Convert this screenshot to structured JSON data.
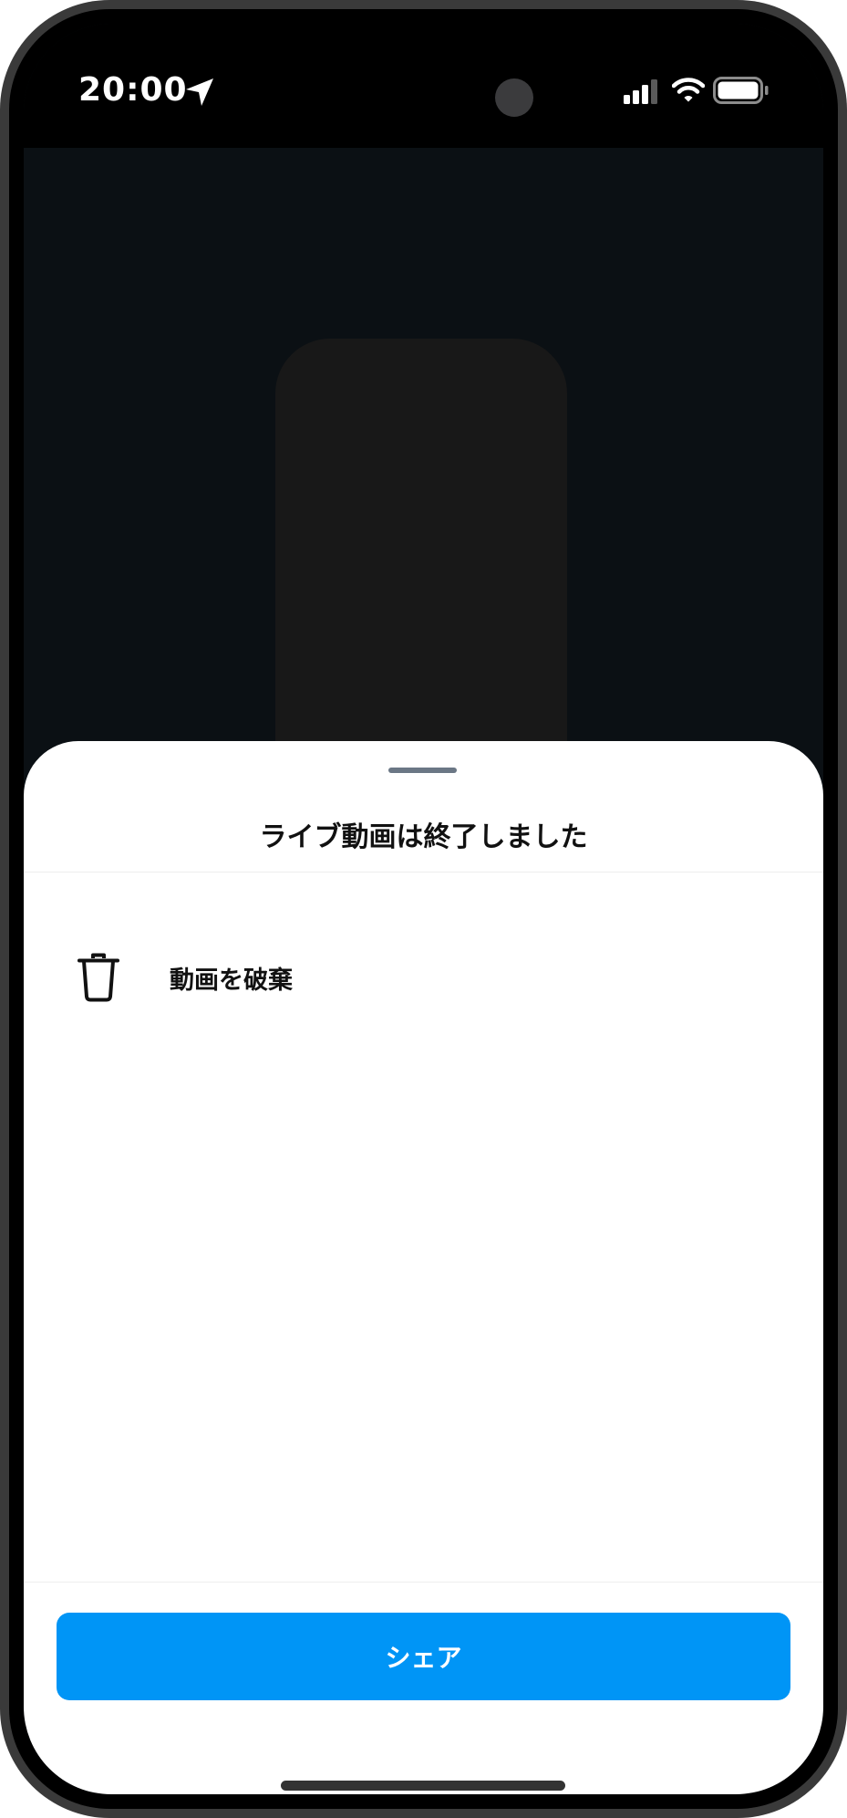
{
  "status_bar": {
    "time": "20:00"
  },
  "sheet": {
    "title": "ライブ動画は終了しました",
    "items": [
      {
        "icon": "trash-icon",
        "label": "動画を破棄"
      }
    ],
    "share_label": "シェア"
  },
  "colors": {
    "accent": "#0095f6",
    "sheet_bg": "#ffffff",
    "video_bg": "#0b1014"
  }
}
